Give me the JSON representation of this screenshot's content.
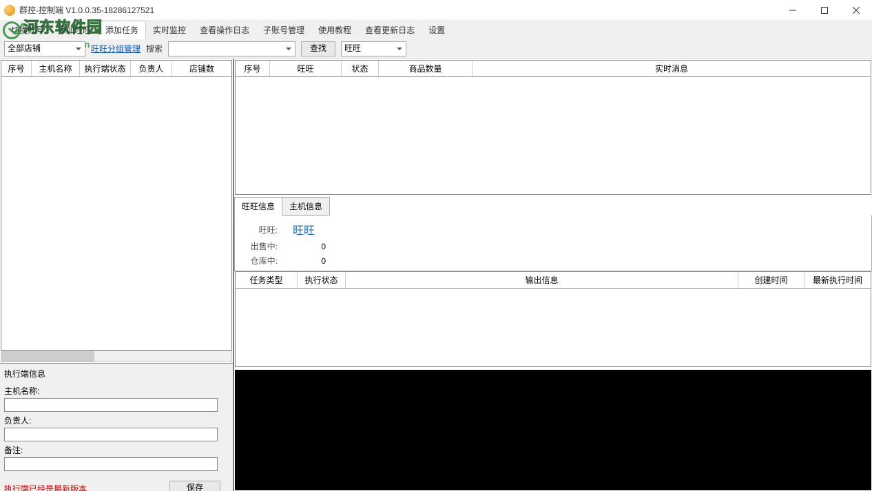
{
  "window": {
    "title": "群控-控制端 V1.0.0.35-18286127521"
  },
  "menu": {
    "items": [
      "切换账号",
      "添加旺旺",
      "添加任务",
      "实时监控",
      "查看操作日志",
      "子账号管理",
      "使用教程",
      "查看更新日志",
      "设置"
    ],
    "selected_index": 2
  },
  "toolbar": {
    "shop_select": "全部店铺",
    "group_link": "旺旺分组管理",
    "search_label": "搜索",
    "search_value": "",
    "find_btn": "查找",
    "filter_select": "旺旺"
  },
  "left_table": {
    "headers": [
      "序号",
      "主机名称",
      "执行端状态",
      "负责人",
      "店铺数"
    ]
  },
  "right_top_table": {
    "headers": [
      "序号",
      "旺旺",
      "状态",
      "商品数量",
      "实时消息"
    ]
  },
  "tabs": {
    "items": [
      "旺旺信息",
      "主机信息"
    ],
    "active": 0
  },
  "detail": {
    "rows": [
      {
        "k": "旺旺:",
        "v": "旺旺",
        "link": true
      },
      {
        "k": "出售中:",
        "v": "0"
      },
      {
        "k": "仓库中:",
        "v": "0"
      }
    ]
  },
  "task_table": {
    "headers": [
      "任务类型",
      "执行状态",
      "输出信息",
      "创建时间",
      "最新执行时间"
    ]
  },
  "exec_panel": {
    "title": "执行端信息",
    "host_label": "主机名称:",
    "owner_label": "负责人:",
    "note_label": "备注:",
    "status_text": "执行端已经是最新版本",
    "save_btn": "保存"
  },
  "watermark": {
    "cn": "河东软件园",
    "en": "www.pc0359.cn"
  }
}
